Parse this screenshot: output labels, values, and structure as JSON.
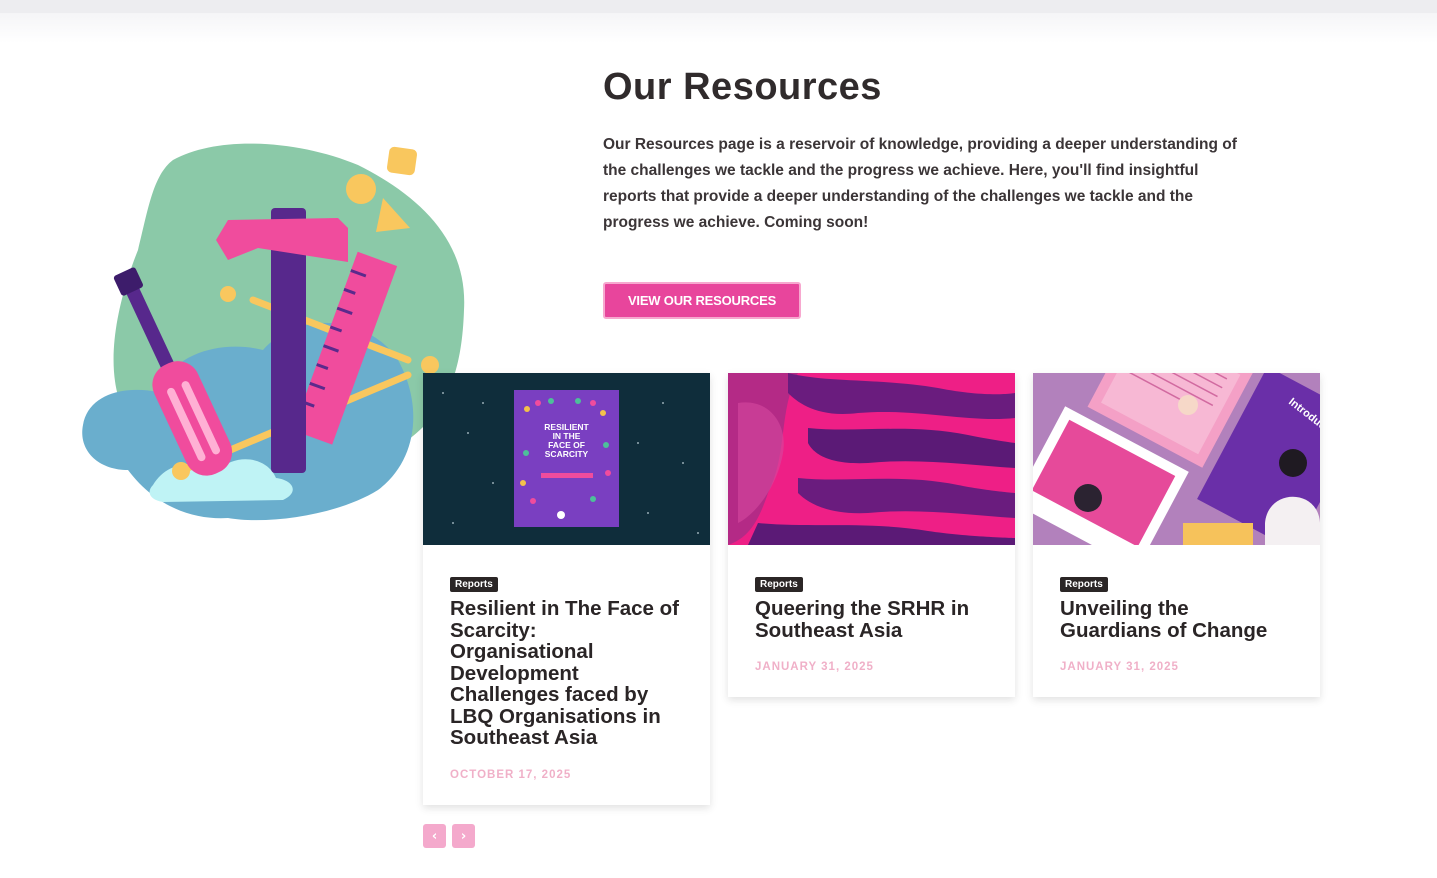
{
  "section": {
    "title": "Our Resources",
    "description": "Our Resources page is a reservoir of knowledge, providing a deeper understanding of the challenges we tackle and the progress we achieve. Here, you'll find insightful reports that provide a deeper understanding of the challenges we tackle and the progress we achieve. Coming soon!",
    "cta_label": "VIEW OUR RESOURCES"
  },
  "cards": [
    {
      "category": "Reports",
      "title": "Resilient in The Face of Scarcity: Organisational Development Challenges faced by LBQ Organisations in Southeast Asia",
      "date": "OCTOBER 17, 2025",
      "cover_text": "RESILIENT IN THE FACE OF SCARCITY"
    },
    {
      "category": "Reports",
      "title": "Queering the SRHR in Southeast Asia",
      "date": "JANUARY 31, 2025"
    },
    {
      "category": "Reports",
      "title": "Unveiling the Guardians of Change",
      "date": "JANUARY 31, 2025",
      "cover_text": "Introduction"
    }
  ],
  "carousel": {
    "prev_icon": "chevron-left-icon",
    "next_icon": "chevron-right-icon"
  },
  "colors": {
    "accent": "#e8459c",
    "accent_light": "#f4a9cc",
    "date_pink": "#f0b0c8",
    "heading": "#302b2c"
  }
}
